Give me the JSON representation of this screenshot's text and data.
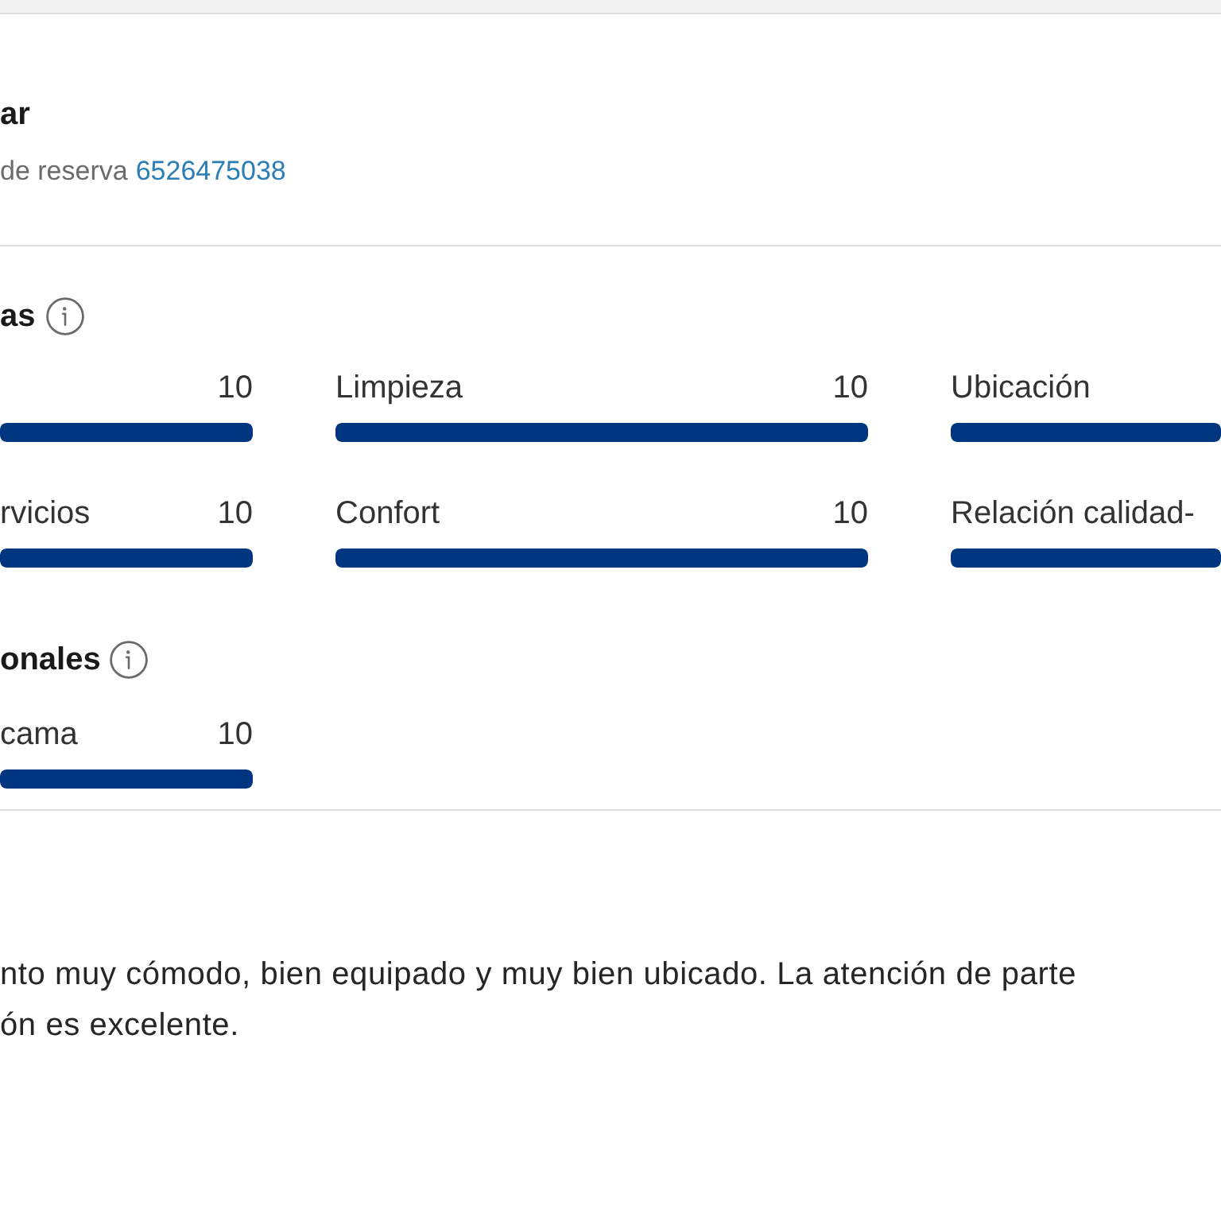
{
  "booking": {
    "title": "ar",
    "reservation_label": "de reserva",
    "reservation_number": "6526475038"
  },
  "scores": {
    "title": "as",
    "items": [
      {
        "score": "10",
        "level": 1
      },
      {
        "label": "Limpieza",
        "score": "10",
        "level": 1
      },
      {
        "label": "Ubicación",
        "level": 1
      },
      {
        "label": "rvicios",
        "score": "10",
        "level": 1
      },
      {
        "label": "Confort",
        "score": "10",
        "level": 1
      },
      {
        "label": "Relación calidad-",
        "level": 1
      }
    ]
  },
  "additional_scores": {
    "title": "onales",
    "items": [
      {
        "label": "cama",
        "score": "10",
        "level": 1
      }
    ]
  },
  "review": {
    "lines": [
      "nto muy cómodo, bien equipado y muy bien ubicado. La atención de parte",
      "ón es excelente."
    ]
  }
}
